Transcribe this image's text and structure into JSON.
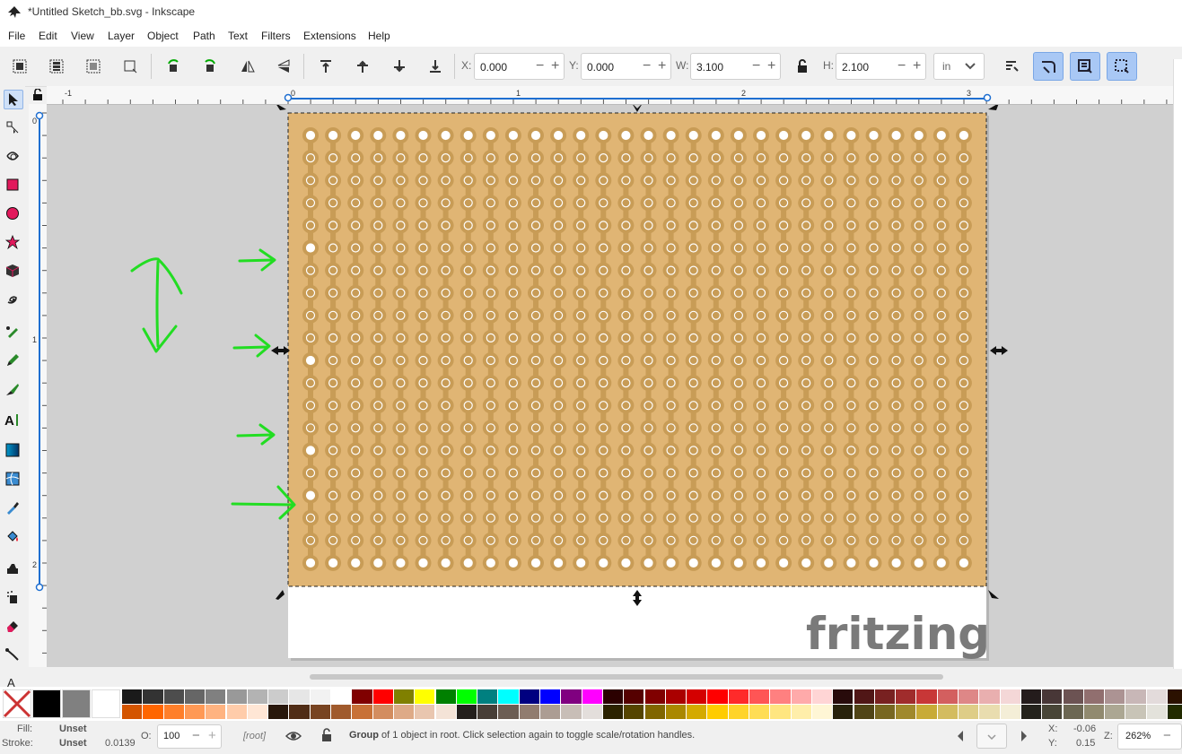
{
  "window": {
    "title": "*Untitled Sketch_bb.svg - Inkscape"
  },
  "menu": [
    "File",
    "Edit",
    "View",
    "Layer",
    "Object",
    "Path",
    "Text",
    "Filters",
    "Extensions",
    "Help"
  ],
  "toolbar": {
    "x_label": "X:",
    "x_value": "0.000",
    "y_label": "Y:",
    "y_value": "0.000",
    "w_label": "W:",
    "w_value": "3.100",
    "h_label": "H:",
    "h_value": "2.100",
    "unit": "in"
  },
  "ruler": {
    "h_labels": [
      "-1",
      "0",
      "1",
      "2",
      "3"
    ],
    "v_labels": [
      "0",
      "1",
      "2"
    ]
  },
  "canvas": {
    "board_color": "#e0b574",
    "board_trace_color": "#c89c56",
    "hole_color": "#ffffff",
    "page_color": "#ffffff",
    "annotation_color": "#22dd22",
    "logo_text": "fritzing",
    "logo_color": "#7a7a7a",
    "grid_columns": 30,
    "grid_rows": 20
  },
  "palette": {
    "row1": [
      "#000000",
      "#808080",
      "#ffffff",
      "#1a1a1a",
      "#333333",
      "#4d4d4d",
      "#666666",
      "#808080",
      "#999999",
      "#b3b3b3",
      "#cccccc",
      "#e6e6e6",
      "#f2f2f2",
      "#ffffff",
      "#800000",
      "#ff0000",
      "#808000",
      "#ffff00",
      "#008000",
      "#00ff00",
      "#008080",
      "#00ffff",
      "#000080",
      "#0000ff",
      "#800080",
      "#ff00ff",
      "#2b0000",
      "#550000",
      "#800000",
      "#aa0000",
      "#d40000",
      "#ff0000",
      "#ff2a2a",
      "#ff5555",
      "#ff8080",
      "#ffaaaa",
      "#ffd5d5",
      "#280b0b",
      "#501616",
      "#782121",
      "#a02c2c",
      "#c83737",
      "#d35f5f",
      "#de8787",
      "#e9afaf",
      "#f4d7d7",
      "#241c1c",
      "#483737",
      "#6c5353",
      "#916f6f",
      "#ac9393",
      "#c8b7b7",
      "#e3dbdb",
      "#2b1100"
    ],
    "row2": [
      "#d45500",
      "#ff6600",
      "#ff7f2a",
      "#ff9955",
      "#ffb380",
      "#ffccaa",
      "#ffe6d5",
      "#28170b",
      "#502d16",
      "#784421",
      "#a05a2c",
      "#c87137",
      "#d38d5f",
      "#deaa87",
      "#e9c6af",
      "#f4e3d7",
      "#241f1c",
      "#483e37",
      "#6c5d53",
      "#917c6f",
      "#ac9d93",
      "#c8beb7",
      "#e3dedb",
      "#2b2200",
      "#554400",
      "#806600",
      "#aa8800",
      "#d4aa00",
      "#ffcc00",
      "#ffd42a",
      "#ffdd55",
      "#ffe680",
      "#ffeeaa",
      "#fff6d5",
      "#28220b",
      "#504416",
      "#786721",
      "#a0892c",
      "#c8ab37",
      "#d3bc5f",
      "#decd87",
      "#e9ddaf",
      "#f4eed7",
      "#24221c",
      "#484537",
      "#6c6753",
      "#918a6f",
      "#aca793",
      "#c8c4b7",
      "#e3e2db",
      "#222b00"
    ]
  },
  "status": {
    "fill_label": "Fill:",
    "fill_value": "Unset",
    "stroke_label": "Stroke:",
    "stroke_value": "Unset",
    "stroke_width": "0.0139",
    "opacity_label": "O:",
    "opacity_value": "100",
    "layer": "[root]",
    "message_bold": "Group",
    "message_rest": " of 1 object in root. Click selection again to toggle scale/rotation handles.",
    "x_label": "X:",
    "x_value": "-0.06",
    "y_label": "Y:",
    "y_value": "0.15",
    "zoom_label": "Z:",
    "zoom_value": "262%"
  }
}
